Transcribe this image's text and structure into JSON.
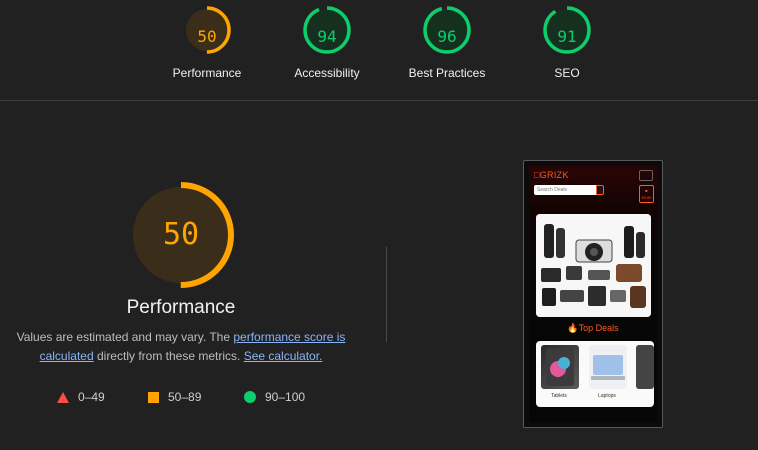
{
  "categories": [
    {
      "name": "Performance",
      "score": "50",
      "value": 0.5,
      "status": "average",
      "color": "#ffa400",
      "bg": "#3a2e1a"
    },
    {
      "name": "Accessibility",
      "score": "94",
      "value": 0.94,
      "status": "pass",
      "color": "#0cce6b",
      "bg": "#16301f"
    },
    {
      "name": "Best Practices",
      "score": "96",
      "value": 0.96,
      "status": "pass",
      "color": "#0cce6b",
      "bg": "#16301f"
    },
    {
      "name": "SEO",
      "score": "91",
      "value": 0.91,
      "status": "pass",
      "color": "#0cce6b",
      "bg": "#16301f"
    }
  ],
  "main": {
    "score": "50",
    "value": 0.5,
    "title": "Performance",
    "desc_prefix": "Values are estimated and may vary. The ",
    "desc_link1": "performance score is calculated",
    "desc_middle": " directly from these metrics. ",
    "desc_link2": "See calculator."
  },
  "legend": [
    {
      "shape": "triangle",
      "range": "0–49",
      "color": "#ff4e42"
    },
    {
      "shape": "square",
      "range": "50–89",
      "color": "#ffa400"
    },
    {
      "shape": "circle",
      "range": "90–100",
      "color": "#0cce6b"
    }
  ],
  "screenshot": {
    "logo": "GRIZK",
    "search_placeholder": "Search Deals",
    "cart_amount": "£0.00",
    "section_title": "Top Deals",
    "category_labels": [
      "Tablets",
      "Laptops"
    ]
  }
}
